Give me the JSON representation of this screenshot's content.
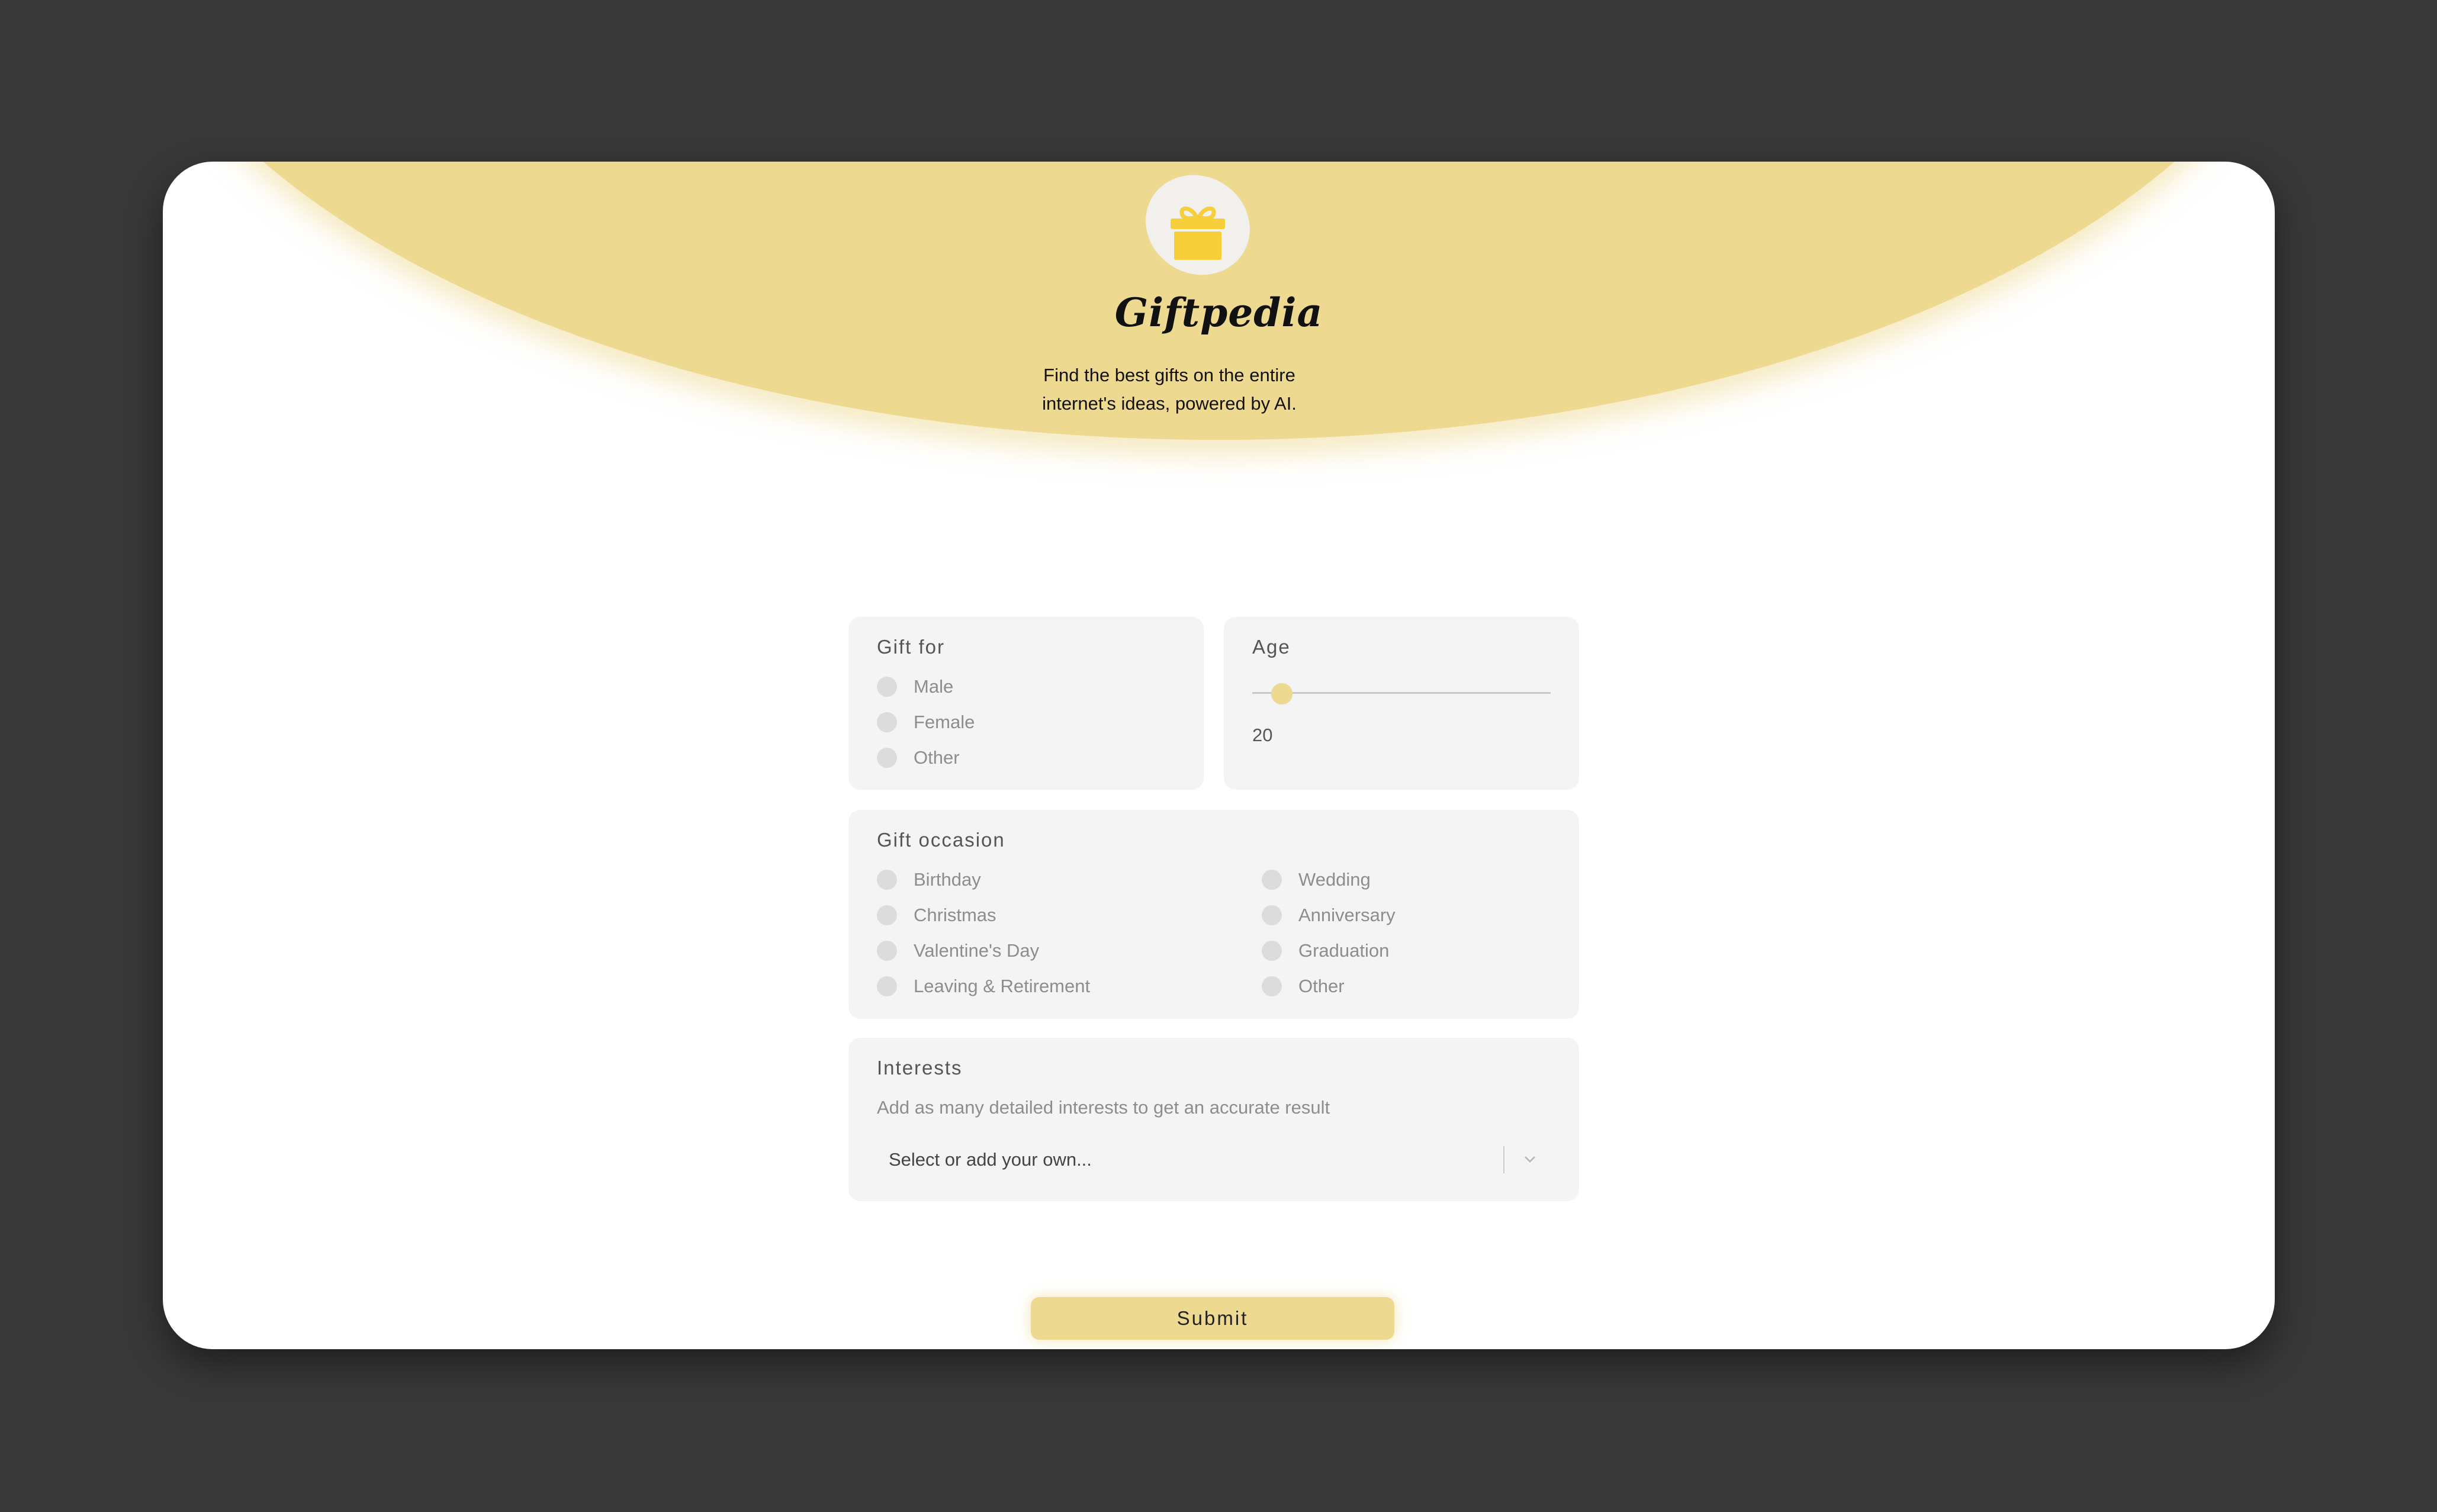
{
  "app": {
    "title": "Giftpedia",
    "subtitle_line1": "Find the best gifts on the entire",
    "subtitle_line2": "internet's ideas, powered by AI.",
    "logo_icon": "gift-icon"
  },
  "gift_for": {
    "title": "Gift for",
    "options": [
      "Male",
      "Female",
      "Other"
    ]
  },
  "age": {
    "title": "Age",
    "value": "20",
    "slider_fraction": 0.1
  },
  "occasion": {
    "title": "Gift occasion",
    "options": [
      "Birthday",
      "Christmas",
      "Valentine's Day",
      "Leaving & Retirement",
      "Wedding",
      "Anniversary",
      "Graduation",
      "Other"
    ]
  },
  "interests": {
    "title": "Interests",
    "hint": "Add as many detailed interests to get an accurate result",
    "placeholder": "Select or add your own..."
  },
  "submit": {
    "label": "Submit"
  },
  "colors": {
    "background": "#383838",
    "accent": "#eed991",
    "gift": "#f7cf3b",
    "panel": "#f4f4f4"
  }
}
